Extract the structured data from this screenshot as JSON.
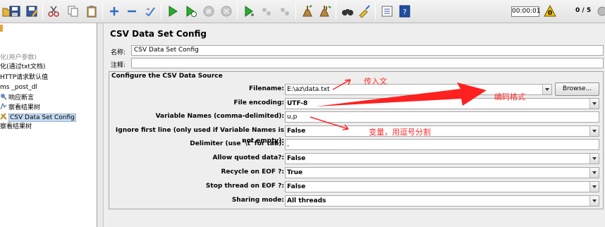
{
  "toolbar": {
    "buttons": [
      "new-icon",
      "open-icon",
      "save-icon",
      "save-as-icon",
      "cut-icon",
      "copy-icon",
      "paste-icon",
      "expand-icon",
      "collapse-icon",
      "toggle-icon",
      "start-icon",
      "start-no-pause-icon",
      "stop-icon",
      "shutdown-icon",
      "remote-start-icon",
      "remote-stop-icon",
      "remote-exit-icon",
      "clear-icon",
      "clear-all-icon",
      "search-icon",
      "reset-search-icon",
      "function-helper-icon",
      "help-icon"
    ],
    "timer": "00:00:01",
    "counts": "0 / 5",
    "warning_count": "0"
  },
  "tree": {
    "items": [
      {
        "label": "化(用户参数)",
        "dim": true
      },
      {
        "label": "化(通过txt文档)",
        "dim": false
      },
      {
        "label": "HTTP请求默认值",
        "dim": false
      },
      {
        "label": "ms _post_dl",
        "dim": false
      },
      {
        "label": "响应断言",
        "dim": false
      },
      {
        "label": "察看结果树",
        "dim": false
      },
      {
        "label": "CSV Data Set Config",
        "dim": false,
        "selected": true
      },
      {
        "label": "察看结果树",
        "dim": false
      }
    ]
  },
  "panel": {
    "title": "CSV Data Set Config",
    "name_label": "名称:",
    "name_value": "CSV Data Set Config",
    "comment_label": "注释:",
    "comment_value": "",
    "group_title": "Configure the CSV Data Source",
    "fields": {
      "filename": {
        "label": "Filename:",
        "value": "E:\\az\\data.txt"
      },
      "encoding": {
        "label": "File encoding:",
        "value": "UTF-8"
      },
      "varnames": {
        "label": "Variable Names (comma-delimited):",
        "value": "u,p"
      },
      "ignore_first": {
        "label": "Ignore first line (only used if Variable Names is not empty):",
        "value": "False"
      },
      "delimiter": {
        "label": "Delimiter (use '\\t' for tab):",
        "value": ","
      },
      "quoted": {
        "label": "Allow quoted data?:",
        "value": "False"
      },
      "recycle": {
        "label": "Recycle on EOF ?:",
        "value": "True"
      },
      "stop_thread": {
        "label": "Stop thread on EOF ?:",
        "value": "False"
      },
      "sharing": {
        "label": "Sharing mode:",
        "value": "All threads"
      }
    },
    "browse_label": "Browse..."
  },
  "annotations": {
    "a1": "传入文",
    "a2": "编码格式",
    "a3": "变量，用逗号分割"
  }
}
